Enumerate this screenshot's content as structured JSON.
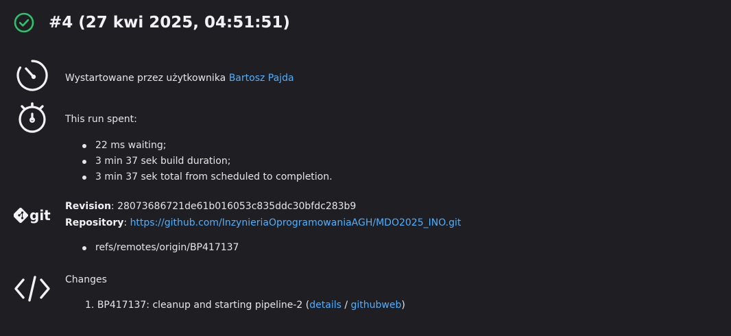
{
  "header": {
    "status_icon": "success-check-circle-icon",
    "title": "#4 (27 kwi 2025, 04:51:51)",
    "accent_color": "#2ec26a"
  },
  "started": {
    "icon": "gauge-icon",
    "text": "Wystartowane przez użytkownika ",
    "user": "Bartosz Pajda"
  },
  "timing": {
    "icon": "stopwatch-icon",
    "heading": "This run spent:",
    "items": [
      "22 ms waiting;",
      "3 min 37 sek build duration;",
      "3 min 37 sek total from scheduled to completion."
    ]
  },
  "git": {
    "icon": "git-logo-icon",
    "revision_label": "Revision",
    "revision_sep": ": ",
    "revision": "28073686721de61b016053c835ddc30bfdc283b9",
    "repository_label": "Repository",
    "repository_sep": ": ",
    "repository_url": "https://github.com/InzynieriaOprogramowaniaAGH/MDO2025_INO.git",
    "refs": [
      "refs/remotes/origin/BP417137"
    ]
  },
  "changes": {
    "icon": "code-icon",
    "heading": "Changes",
    "items": [
      {
        "number": "1.",
        "message": "BP417137: cleanup and starting pipeline-2 (",
        "details_label": "details",
        "separator": " / ",
        "githubweb_label": "githubweb",
        "close": ")"
      }
    ]
  },
  "colors": {
    "background": "#1f1e23",
    "text": "#e6e6e9",
    "link": "#4fb0ff",
    "success": "#2ec26a"
  }
}
